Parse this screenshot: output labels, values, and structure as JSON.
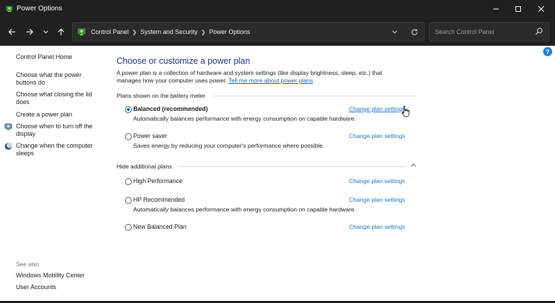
{
  "window": {
    "title": "Power Options",
    "controls": [
      "minimize",
      "maximize",
      "close"
    ]
  },
  "address_bar": {
    "breadcrumbs": [
      "Control Panel",
      "System and Security",
      "Power Options"
    ],
    "search_placeholder": "Search Control Panel"
  },
  "sidebar": {
    "items": [
      {
        "label": "Control Panel Home",
        "icon": null
      },
      {
        "label": "Choose what the power buttons do",
        "icon": null
      },
      {
        "label": "Choose what closing the lid does",
        "icon": null
      },
      {
        "label": "Create a power plan",
        "icon": null
      },
      {
        "label": "Choose when to turn off the display",
        "icon": "monitor-icon"
      },
      {
        "label": "Change when the computer sleeps",
        "icon": "moon-icon"
      }
    ],
    "see_also": {
      "label": "See also",
      "items": [
        "Windows Mobility Center",
        "User Accounts"
      ]
    }
  },
  "main": {
    "title": "Choose or customize a power plan",
    "description": "A power plan is a collection of hardware and system settings (like display brightness, sleep, etc.) that manages how your computer uses power.",
    "description_link": "Tell me more about power plans",
    "battery_section_label": "Plans shown on the battery meter",
    "hidden_section_label": "Hide additional plans",
    "change_link_label": "Change plan settings",
    "battery_plans": [
      {
        "name": "Balanced (recommended)",
        "description": "Automatically balances performance with energy consumption on capable hardware.",
        "selected": true
      },
      {
        "name": "Power saver",
        "description": "Saves energy by reducing your computer's performance where possible.",
        "selected": false
      }
    ],
    "additional_plans": [
      {
        "name": "High Performance",
        "description": "",
        "selected": false
      },
      {
        "name": "HP Recommended",
        "description": "Automatically balances performance with energy consumption on capable hardware.",
        "selected": false
      },
      {
        "name": "New Balanced Plan",
        "description": "",
        "selected": false
      }
    ]
  },
  "colors": {
    "title_blue": "#1e3287",
    "link_blue": "#1a73c9",
    "chrome_dark": "#202020"
  }
}
